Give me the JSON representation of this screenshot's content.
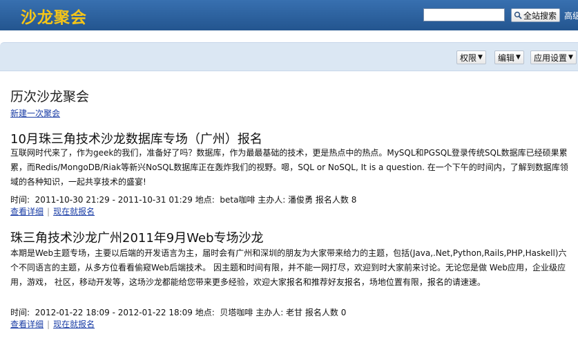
{
  "header": {
    "logo": "沙龙聚会",
    "search_value": "",
    "search_button": "全站搜索",
    "advanced": "高级"
  },
  "toolbar": {
    "permissions": "权限",
    "edit": "编辑",
    "app_settings": "应用设置"
  },
  "main": {
    "title": "历次沙龙聚会",
    "new_link": "新建一次聚会",
    "events": [
      {
        "title": "10月珠三角技术沙龙数据库专场（广州）报名",
        "description": "互联网时代来了，作为geek的我们，准备好了吗？数据库，作为最最基础的技术，更是热点中的热点。MySQL和PGSQL登录传统SQL数据库已经硕果累累，而Redis/MongoDB/Riak等新兴NoSQL数据库正在轰炸我们的视野。嗯，SQL or NoSQL, It is a question. 在一个下午的时间内，了解到数据库领域的各种知识，一起共享技术的盛宴!",
        "meta": "时间:  2011-10-30 21:29 - 2011-10-31 01:29 地点:  beta咖啡 主办人: 潘俊勇 报名人数 8",
        "view": "查看详细",
        "register": "现在就报名"
      },
      {
        "title": "珠三角技术沙龙广州2011年9月Web专场沙龙",
        "description": "本期是Web主题专场，主要以后端的开发语言为主，届时会有广州和深圳的朋友为大家带来给力的主题，包括(Java,.Net,Python,Rails,PHP,Haskell)六个不同语言的主题，从多方位看看偷窥Web后端技术。 因主题和时间有限，并不能一网打尽，欢迎到时大家前来讨论。无论您是做 Web应用，企业级应用，游戏， 社区，移动开发等，这场沙龙都能给您带来更多经验，欢迎大家报名和推荐好友报名，场地位置有限，报名的请速速。",
        "meta": "时间:  2012-01-22 18:09 - 2012-01-22 18:09 地点:  贝塔咖啡 主办人: 老甘 报名人数 0",
        "view": "查看详细",
        "register": "现在就报名"
      }
    ]
  }
}
